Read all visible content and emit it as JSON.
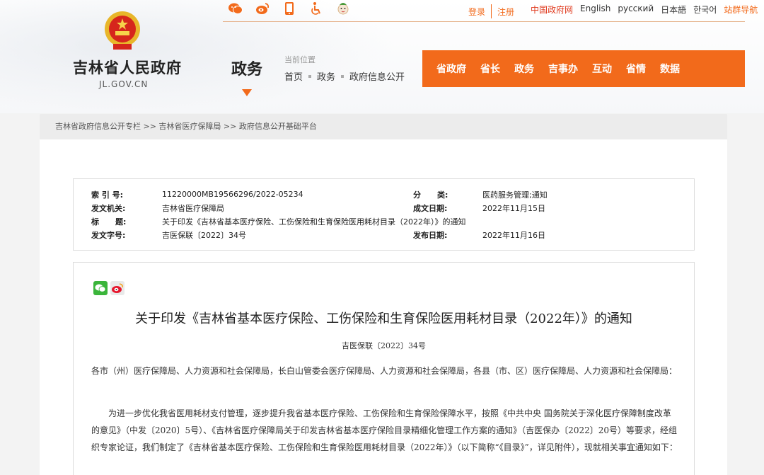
{
  "header": {
    "site_title": "吉林省人民政府",
    "site_domain": "JL.GOV.CN",
    "section_label": "政务",
    "emblem_icon": "national-emblem-icon"
  },
  "topbar": {
    "icons": [
      "wechat-icon",
      "weibo-icon",
      "mobile-icon",
      "accessibility-icon",
      "mascot-icon"
    ],
    "login": "登录",
    "register": "注册",
    "gov_site": "中国政府网",
    "langs": [
      "English",
      "русский",
      "日本語",
      "한국어"
    ],
    "site_nav": "站群导航",
    "accent_color": "#f26a1b"
  },
  "location": {
    "label": "当前位置",
    "path": [
      "首页",
      "政务",
      "政府信息公开"
    ]
  },
  "main_nav": {
    "items": [
      "省政府",
      "省长",
      "政务",
      "吉事办",
      "互动",
      "省情",
      "数据"
    ]
  },
  "crumb": {
    "text": "吉林省政府信息公开专栏 >> 吉林省医疗保障局 >> 政府信息公开基础平台"
  },
  "meta": {
    "index_label": "索 引 号:",
    "index_value": "11220000MB19566296/2022-05234",
    "category_label": "分      类:",
    "category_value": "医药服务管理;通知",
    "issuer_label": "发文机关:",
    "issuer_value": "吉林省医疗保障局",
    "created_label": "成文日期:",
    "created_value": "2022年11月15日",
    "title_label": "标      题:",
    "title_value": "关于印发《吉林省基本医疗保险、工伤保险和生育保险医用耗材目录（2022年）》的通知",
    "docno_label": "发文字号:",
    "docno_value": "吉医保联〔2022〕34号",
    "published_label": "发布日期:",
    "published_value": "2022年11月16日"
  },
  "article": {
    "share_icons": [
      "wechat-share-icon",
      "weibo-share-icon"
    ],
    "title": "关于印发《吉林省基本医疗保险、工伤保险和生育保险医用耗材目录（2022年）》的通知",
    "doc_no": "吉医保联〔2022〕34号",
    "p1": "各市（州）医疗保障局、人力资源和社会保障局，长白山管委会医疗保障局、人力资源和社会保障局，各县（市、区）医疗保障局、人力资源和社会保障局：",
    "p2": "为进一步优化我省医用耗材支付管理，逐步提升我省基本医疗保险、工伤保险和生育保险保障水平，按照《中共中央 国务院关于深化医疗保障制度改革的意见》（中发〔2020〕5号）、《吉林省医疗保障局关于印发吉林省基本医疗保险目录精细化管理工作方案的通知》（吉医保办〔2022〕20号）等要求，经组织专家论证，我们制定了《吉林省基本医疗保险、工伤保险和生育保险医用耗材目录（2022年）》（以下简称“《目录》”，详见附件），现就相关事宜通知如下："
  }
}
